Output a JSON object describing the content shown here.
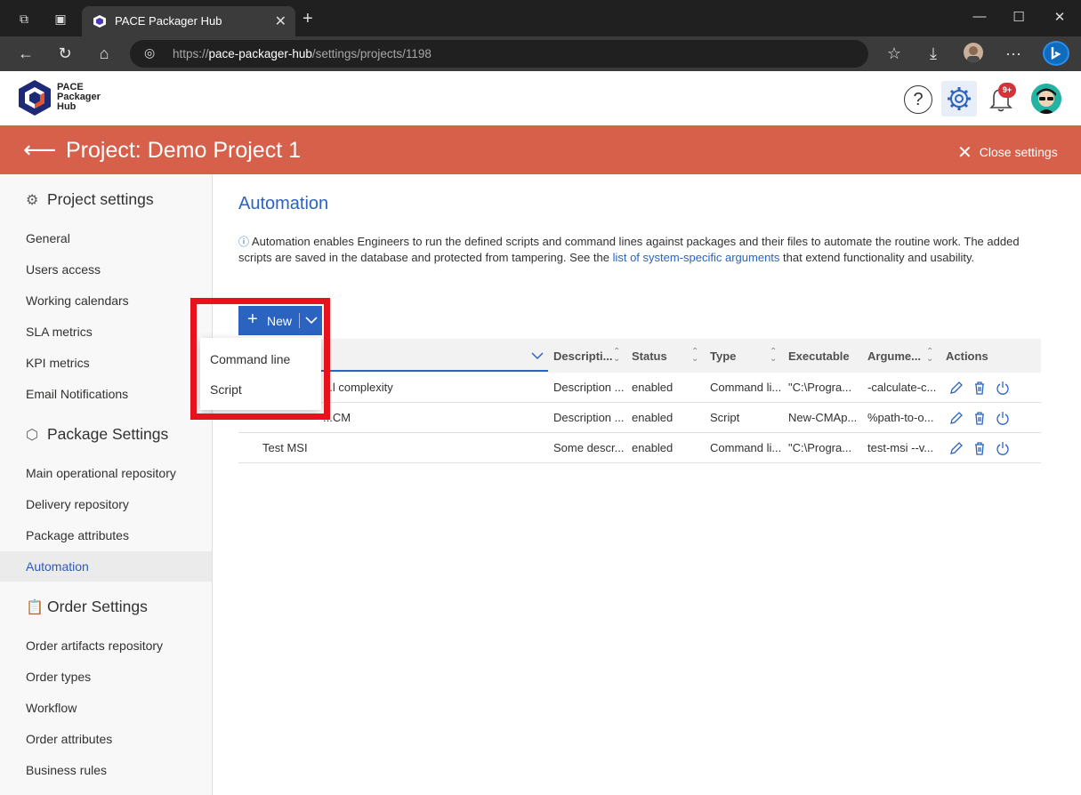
{
  "browser": {
    "tab_title": "PACE Packager Hub",
    "url_prefix": "https://",
    "url_host": "pace-packager-hub",
    "url_path": "/settings/projects/1198"
  },
  "app": {
    "logo_line1": "PACE",
    "logo_line2": "Packager",
    "logo_line3": "Hub",
    "help_label": "?",
    "notifications_badge": "9+"
  },
  "banner": {
    "title": "Project: Demo Project 1",
    "close_label": "Close settings"
  },
  "sidebar": {
    "project_settings": {
      "heading": "Project settings",
      "items": [
        "General",
        "Users access",
        "Working calendars",
        "SLA metrics",
        "KPI metrics",
        "Email Notifications"
      ]
    },
    "package_settings": {
      "heading": "Package Settings",
      "items": [
        "Main operational repository",
        "Delivery repository",
        "Package attributes",
        "Automation"
      ]
    },
    "order_settings": {
      "heading": "Order Settings",
      "items": [
        "Order artifacts repository",
        "Order types",
        "Workflow",
        "Order attributes",
        "Business rules"
      ]
    },
    "active_item": "Automation"
  },
  "main": {
    "title": "Automation",
    "desc_before": "Automation enables Engineers to run the defined scripts and command lines against packages and their files to automate the routine work. The added scripts are saved in the database and protected from tampering. See the ",
    "desc_link": "list of system-specific arguments",
    "desc_after": " that extend functionality and usability.",
    "new_button": "New",
    "dropdown": [
      "Command line",
      "Script"
    ],
    "columns": [
      "Descripti...",
      "Status",
      "Type",
      "Executable",
      "Argume...",
      "Actions"
    ],
    "rows": [
      {
        "name": "...l complexity",
        "description": "Description ...",
        "status": "enabled",
        "type": "Command li...",
        "executable": "\"C:\\Progra...",
        "arguments": "-calculate-c..."
      },
      {
        "name": "...CM",
        "description": "Description ...",
        "status": "enabled",
        "type": "Script",
        "executable": "New-CMAp...",
        "arguments": "%path-to-o..."
      },
      {
        "name": "Test MSI",
        "description": "Some descr...",
        "status": "enabled",
        "type": "Command li...",
        "executable": "\"C:\\Progra...",
        "arguments": "test-msi --v..."
      }
    ]
  },
  "colors": {
    "banner": "#d6604a",
    "accent": "#2b63c0",
    "highlight": "#e8111e"
  }
}
